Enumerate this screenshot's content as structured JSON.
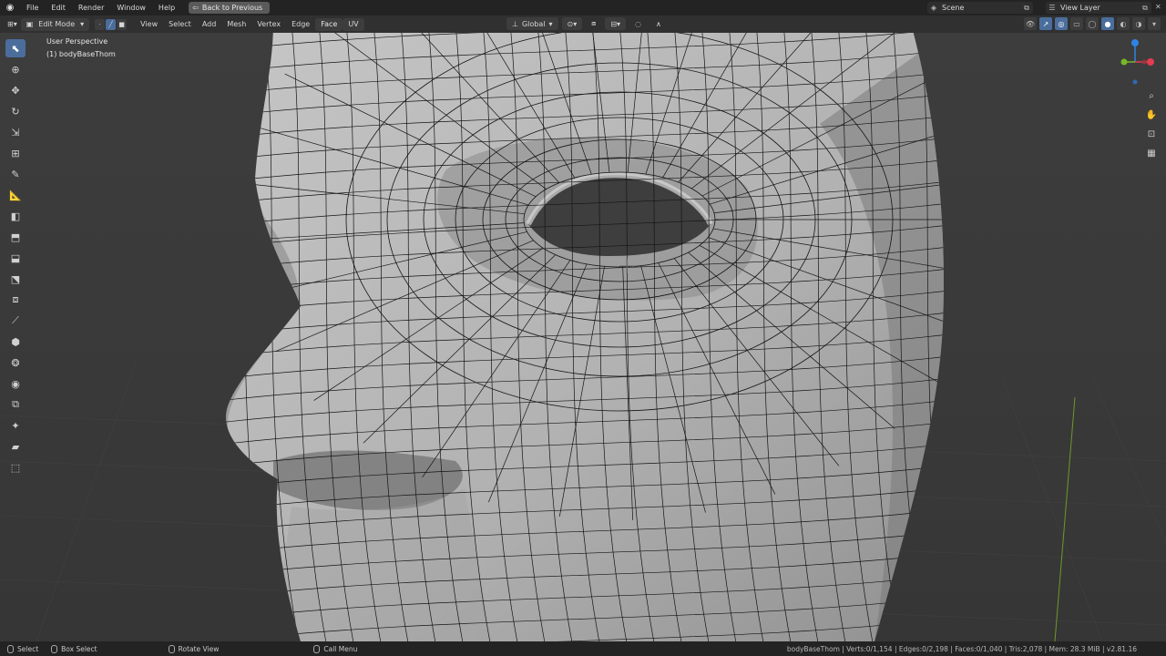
{
  "menubar": {
    "items": [
      "File",
      "Edit",
      "Render",
      "Window",
      "Help"
    ],
    "back_button": "Back to Previous",
    "scene": "Scene",
    "view_layer": "View Layer"
  },
  "header": {
    "mode": "Edit Mode",
    "menus": [
      "View",
      "Select",
      "Add",
      "Mesh",
      "Vertex",
      "Edge",
      "Face",
      "UV"
    ],
    "transform_orientation": "Global"
  },
  "viewport": {
    "perspective": "User Perspective",
    "object": "(1) bodyBaseThom"
  },
  "toolbar": {
    "tools": [
      "select-box-icon",
      "cursor-icon",
      "move-icon",
      "rotate-icon",
      "scale-icon",
      "transform-icon",
      "annotate-icon",
      "measure-icon",
      "add-cube-icon",
      "extrude-icon",
      "inset-icon",
      "bevel-icon",
      "loop-cut-icon",
      "knife-icon",
      "poly-build-icon",
      "spin-icon",
      "smooth-icon",
      "edge-slide-icon",
      "shrink-fatten-icon",
      "shear-icon",
      "rip-icon"
    ]
  },
  "statusbar": {
    "select": "Select",
    "box_select": "Box Select",
    "rotate_view": "Rotate View",
    "call_menu": "Call Menu",
    "stats": "bodyBaseThom | Verts:0/1,154 | Edges:0/2,198 | Faces:0/1,040 | Tris:2,078 | Mem: 28.3 MiB | v2.81.16"
  },
  "colors": {
    "background": "#3a3a3a",
    "mesh_face": "#b4b4b4",
    "mesh_wire": "#101010",
    "active_blue": "#4a6d9c",
    "axis_x": "#e53b4e",
    "axis_y": "#76b82a",
    "axis_z": "#2f84e3"
  }
}
